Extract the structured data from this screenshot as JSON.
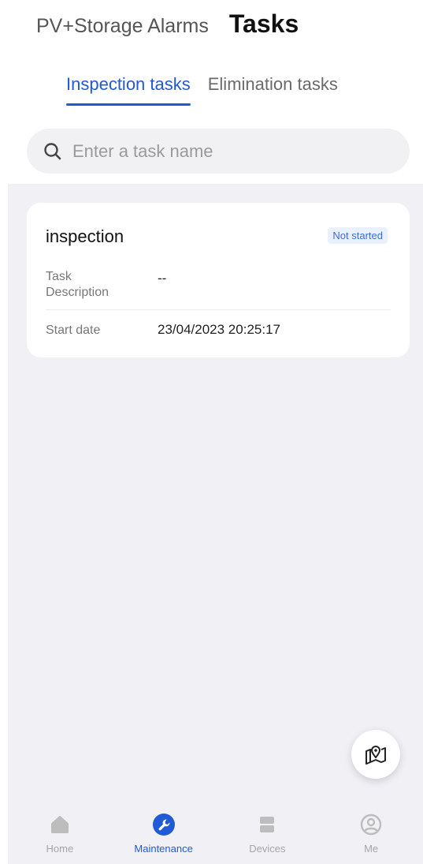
{
  "header": {
    "tabs": [
      {
        "label": "PV+Storage Alarms",
        "active": false
      },
      {
        "label": "Tasks",
        "active": true
      }
    ]
  },
  "subtabs": [
    {
      "label": "Inspection tasks",
      "active": true
    },
    {
      "label": "Elimination tasks",
      "active": false
    }
  ],
  "search": {
    "placeholder": "Enter a task name",
    "value": "",
    "icon": "search-icon"
  },
  "tasks": [
    {
      "title": "inspection",
      "status": "Not started",
      "fields": [
        {
          "label": "Task\nDescription",
          "value": "--"
        },
        {
          "label": "Start date",
          "value": "23/04/2023 20:25:17"
        }
      ]
    }
  ],
  "fab": {
    "icon": "map-location-icon"
  },
  "bottom_nav": [
    {
      "label": "Home",
      "icon": "home-icon",
      "active": false
    },
    {
      "label": "Maintenance",
      "icon": "wrench-icon",
      "active": true
    },
    {
      "label": "Devices",
      "icon": "devices-icon",
      "active": false
    },
    {
      "label": "Me",
      "icon": "user-icon",
      "active": false
    }
  ],
  "colors": {
    "accent": "#1f5bd6",
    "background": "#f0f0f5",
    "badge_bg": "#eaf0fc",
    "inactive": "#a6a6a6"
  }
}
